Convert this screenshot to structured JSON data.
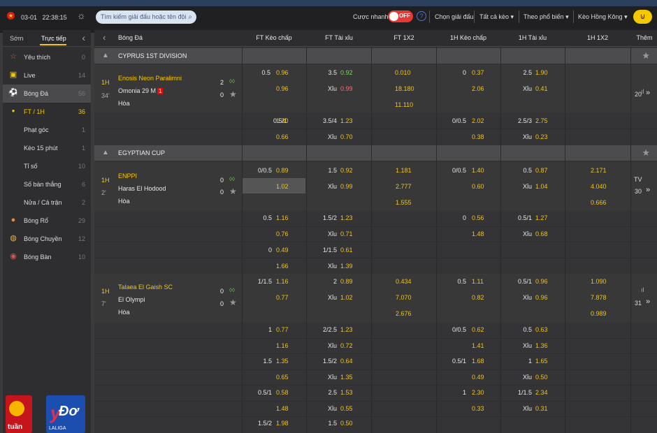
{
  "topbar": {
    "date": "03-01",
    "time": "22:38:15",
    "search_placeholder": "Tìm kiếm giải đấu hoặc tên đội",
    "quick_bet_label": "Cược nhanh",
    "toggle_label": "OFF",
    "select_league": "Chọn giải đấu",
    "all_bets": "Tất cả kèo",
    "sort": "Theo phổ biến",
    "odds_type": "Kèo Hồng Kông"
  },
  "sidebar": {
    "tab_early": "Sớm",
    "tab_live": "Trực tiếp",
    "items": [
      {
        "label": "Yêu thích",
        "count": "0"
      },
      {
        "label": "Live",
        "count": "14"
      },
      {
        "label": "Bóng Đá",
        "count": "56"
      },
      {
        "label": "FT / 1H",
        "count": "36"
      },
      {
        "label": "Phạt góc",
        "count": "1"
      },
      {
        "label": "Kèo 15 phút",
        "count": "1"
      },
      {
        "label": "Tỉ số",
        "count": "10"
      },
      {
        "label": "Số bàn thắng",
        "count": "6"
      },
      {
        "label": "Nửa / Cả trận",
        "count": "2"
      },
      {
        "label": "Bóng Rổ",
        "count": "29"
      },
      {
        "label": "Bóng Chuyền",
        "count": "12"
      },
      {
        "label": "Bóng Bàn",
        "count": "10"
      }
    ],
    "promo1_text": "tuần",
    "promo2_text": "Đơ",
    "promo2_sub": "LALIGA"
  },
  "header": {
    "sport": "Bóng Đá",
    "ft_hdp": "FT Kèo chấp",
    "ft_ou": "FT Tài xỉu",
    "ft_1x2": "FT 1X2",
    "h1_hdp": "1H Kèo chấp",
    "h1_ou": "1H Tài xỉu",
    "h1_1x2": "1H 1X2",
    "more": "Thêm"
  },
  "leagues": [
    {
      "name": "CYPRUS 1ST DIVISION"
    },
    {
      "name": "EGYPTIAN CUP"
    }
  ],
  "matches": [
    {
      "period": "1H",
      "minute": "34'",
      "home": "Enosis Neon Paralimni",
      "away": "Omonia 29 M",
      "red": "1",
      "draw": "Hòa",
      "home_score": "2",
      "away_score": "0",
      "more": "20",
      "tv": ""
    },
    {
      "period": "1H",
      "minute": "2'",
      "home": "ENPPI",
      "away": "Haras El Hodood",
      "red": "",
      "draw": "Hòa",
      "home_score": "0",
      "away_score": "0",
      "more": "30",
      "tv": "TV"
    },
    {
      "period": "1H",
      "minute": "7'",
      "home": "Talaea El Gaish SC",
      "away": "El Olympi",
      "red": "",
      "draw": "Hòa",
      "home_score": "0",
      "away_score": "0",
      "more": "31",
      "tv": ""
    }
  ],
  "odds": {
    "m1": {
      "hdp": "0.5",
      "hdp_h": "0.96",
      "hdp_a": "0.96",
      "ou": "3.5",
      "ou_o": "0.92",
      "xiu": "Xỉu",
      "ou_u": "0.99",
      "x1": "0.010",
      "x2": "18.180",
      "xd": "11.110",
      "h1hdp": "0",
      "h1hdp_h": "0.37",
      "h1hdp_a": "2.06",
      "h1ou": "2.5",
      "h1ou_o": "1.90",
      "h1ou_u": "0.41"
    },
    "m1b": {
      "hdp": "0.5/1",
      "hdp_h": "1.30",
      "hdp_a": "0.66",
      "ou": "3.5/4",
      "ou_o": "1.23",
      "ou_u": "0.70",
      "h1hdp": "0/0.5",
      "h1hdp_h": "2.02",
      "h1hdp_a": "0.38",
      "h1ou": "2.5/3",
      "h1ou_o": "2.75",
      "h1ou_u": "0.23"
    },
    "m2": {
      "hdp": "0/0.5",
      "hdp_h": "0.89",
      "hdp_a": "1.02",
      "ou": "1.5",
      "ou_o": "0.92",
      "ou_u": "0.99",
      "x1": "1.181",
      "x2": "2.777",
      "xd": "1.555",
      "h1hdp": "0/0.5",
      "h1hdp_h": "1.40",
      "h1hdp_a": "0.60",
      "h1ou": "0.5",
      "h1ou_o": "0.87",
      "h1ou_u": "1.04",
      "h1x1": "2.171",
      "h1x2": "4.040",
      "h1xd": "0.666"
    },
    "m2b": {
      "hdp": "0.5",
      "hdp_h": "1.16",
      "hdp_a": "0.76",
      "ou": "1.5/2",
      "ou_o": "1.23",
      "ou_u": "0.71",
      "h1hdp": "0",
      "h1hdp_h": "0.56",
      "h1hdp_a": "1.48",
      "h1ou": "0.5/1",
      "h1ou_o": "1.27",
      "h1ou_u": "0.68"
    },
    "m2c": {
      "hdp": "0",
      "hdp_h": "0.49",
      "hdp_a": "1.66",
      "ou": "1/1.5",
      "ou_o": "0.61",
      "ou_u": "1.39"
    },
    "m3": {
      "hdp": "1/1.5",
      "hdp_h": "1.16",
      "hdp_a": "0.77",
      "ou": "2",
      "ou_o": "0.89",
      "ou_u": "1.02",
      "x1": "0.434",
      "x2": "7.070",
      "xd": "2.676",
      "h1hdp": "0.5",
      "h1hdp_h": "1.11",
      "h1hdp_a": "0.82",
      "h1ou": "0.5/1",
      "h1ou_o": "0.96",
      "h1ou_u": "0.96",
      "h1x1": "1.090",
      "h1x2": "7.878",
      "h1xd": "0.989"
    },
    "m3b": {
      "hdp": "1",
      "hdp_h": "0.77",
      "hdp_a": "1.16",
      "ou": "2/2.5",
      "ou_o": "1.23",
      "ou_u": "0.72",
      "h1hdp": "0/0.5",
      "h1hdp_h": "0.62",
      "h1hdp_a": "1.41",
      "h1ou": "0.5",
      "h1ou_o": "0.63",
      "h1ou_u": "1.36"
    },
    "m3c": {
      "hdp": "1.5",
      "hdp_h": "1.35",
      "hdp_a": "0.65",
      "ou": "1.5/2",
      "ou_o": "0.64",
      "ou_u": "1.35",
      "h1hdp": "0.5/1",
      "h1hdp_h": "1.68",
      "h1hdp_a": "0.49",
      "h1ou": "1",
      "h1ou_o": "1.65",
      "h1ou_u": "0.50"
    },
    "m3d": {
      "hdp": "0.5/1",
      "hdp_h": "0.58",
      "hdp_a": "1.48",
      "ou": "2.5",
      "ou_o": "1.53",
      "ou_u": "0.55",
      "h1hdp": "1",
      "h1hdp_h": "2.30",
      "h1hdp_a": "0.33",
      "h1ou": "1/1.5",
      "h1ou_o": "2.34",
      "h1ou_u": "0.31"
    },
    "m3e": {
      "hdp": "1.5/2",
      "hdp_h": "1.98",
      "ou": "1.5",
      "ou_o": "0.50"
    }
  }
}
